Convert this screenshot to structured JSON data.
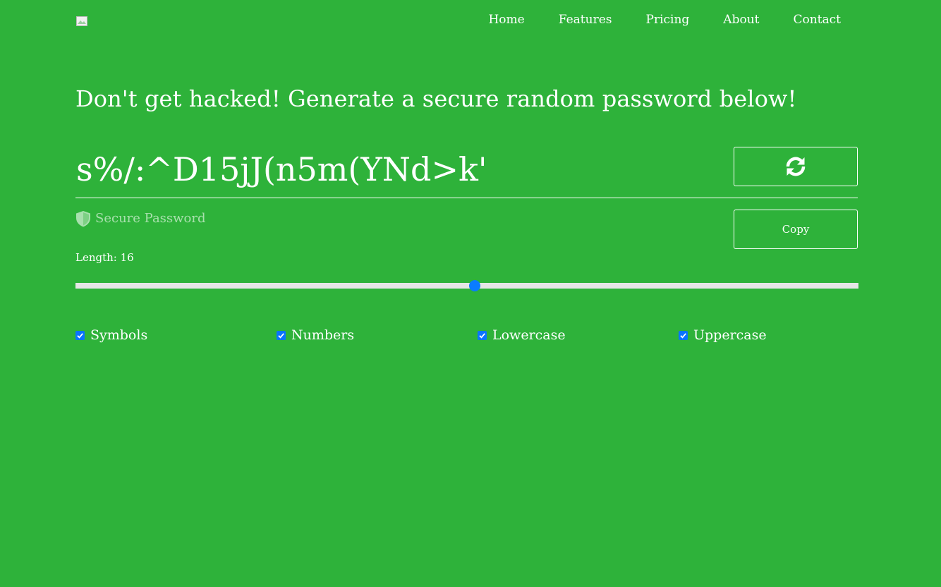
{
  "nav": {
    "items": [
      {
        "label": "Home"
      },
      {
        "label": "Features"
      },
      {
        "label": "Pricing"
      },
      {
        "label": "About"
      },
      {
        "label": "Contact"
      }
    ]
  },
  "headline": "Don't get hacked! Generate a secure random password below!",
  "password": {
    "value": "s%/:^D15jJ(n5m(YNd>k'",
    "refresh_icon": "refresh-icon",
    "copy_label": "Copy"
  },
  "strength": {
    "icon": "shield-icon",
    "label": "Secure Password",
    "color": "#a8e0ad"
  },
  "length": {
    "label": "Length: 16",
    "slider_fraction": 0.51
  },
  "options": [
    {
      "label": "Symbols",
      "checked": true
    },
    {
      "label": "Numbers",
      "checked": true
    },
    {
      "label": "Lowercase",
      "checked": true
    },
    {
      "label": "Uppercase",
      "checked": true
    }
  ],
  "colors": {
    "background": "#2eb23a",
    "accent": "#0a7cff",
    "text": "#ffffff"
  }
}
